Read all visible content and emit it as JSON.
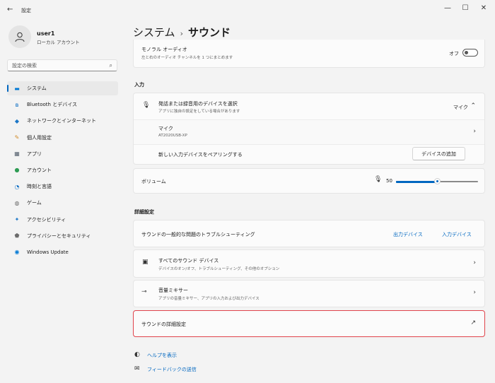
{
  "window": {
    "title": "設定",
    "back_icon": "←",
    "controls": {
      "minimize": "—",
      "maximize": "☐",
      "close": "✕"
    }
  },
  "profile": {
    "name": "user1",
    "account_type": "ローカル アカウント"
  },
  "search": {
    "placeholder": "設定の検索",
    "icon": "⌕"
  },
  "sidebar": {
    "items": [
      {
        "label": "システム",
        "icon": "▬",
        "icon_color": "#0078d4",
        "active": true
      },
      {
        "label": "Bluetooth とデバイス",
        "icon": "ʙ",
        "icon_color": "#0067c0"
      },
      {
        "label": "ネットワークとインターネット",
        "icon": "◆",
        "icon_color": "#1a76c7"
      },
      {
        "label": "個人用設定",
        "icon": "✎",
        "icon_color": "#d18b2a"
      },
      {
        "label": "アプリ",
        "icon": "▦",
        "icon_color": "#55606e"
      },
      {
        "label": "アカウント",
        "icon": "●",
        "icon_color": "#2d9b53"
      },
      {
        "label": "時刻と言語",
        "icon": "◔",
        "icon_color": "#1a76c7"
      },
      {
        "label": "ゲーム",
        "icon": "◍",
        "icon_color": "#6b6b6b"
      },
      {
        "label": "アクセシビリティ",
        "icon": "✦",
        "icon_color": "#1a76c7"
      },
      {
        "label": "プライバシーとセキュリティ",
        "icon": "⬟",
        "icon_color": "#6b6b6b"
      },
      {
        "label": "Windows Update",
        "icon": "◉",
        "icon_color": "#0078d4"
      }
    ]
  },
  "breadcrumb": {
    "parent": "システム",
    "separator": "›",
    "current": "サウンド"
  },
  "mono_audio": {
    "title": "モノラル オーディオ",
    "subtitle": "左と右のオーディオ チャンネルを 1 つにまとめます",
    "toggle_label": "オフ",
    "on": false
  },
  "input": {
    "section_label": "入力",
    "select": {
      "title": "発話または録音用のデバイスを選択",
      "subtitle": "アプリに独自の設定をしている場合があります",
      "value": "マイク",
      "chevron": "⌃"
    },
    "device": {
      "title": "マイク",
      "subtitle": "AT2020USB-XP",
      "chevron": "›"
    },
    "pair": {
      "title": "新しい入力デバイスをペアリングする",
      "button": "デバイスの追加"
    },
    "volume": {
      "label": "ボリューム",
      "value": "50",
      "level": 0.5
    }
  },
  "advanced": {
    "section_label": "詳細設定",
    "troubleshoot": {
      "title": "サウンドの一般的な問題のトラブルシューティング",
      "link_output": "出力デバイス",
      "link_input": "入力デバイス"
    },
    "all_devices": {
      "title": "すべてのサウンド デバイス",
      "subtitle": "デバイスのオン/オフ、トラブルシューティング、その他のオプション",
      "chevron": "›"
    },
    "mixer": {
      "title": "音量ミキサー",
      "subtitle": "アプリの音量ミキサー、アプリの入力および出力デバイス",
      "chevron": "›"
    },
    "more": {
      "title": "サウンドの詳細設定",
      "icon": "↗"
    }
  },
  "footer": {
    "help": "ヘルプを表示",
    "feedback": "フィードバックの送信"
  }
}
